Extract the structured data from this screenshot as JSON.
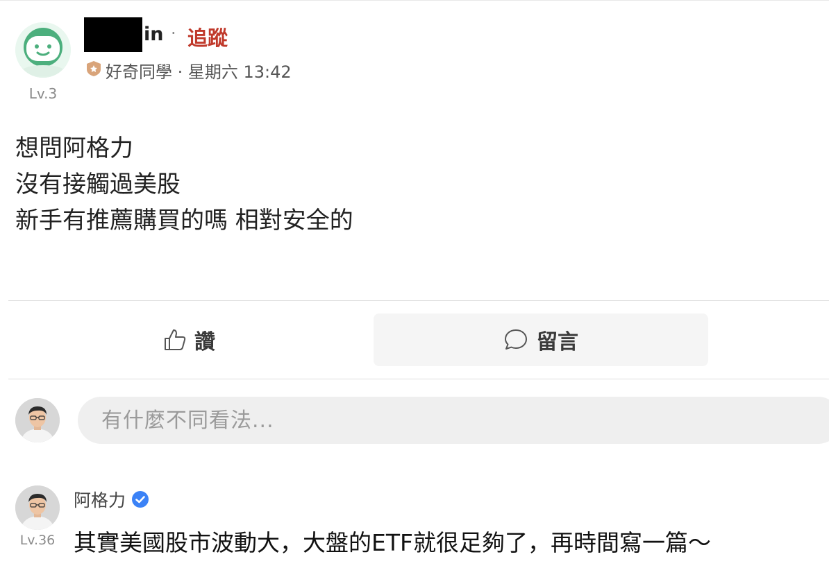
{
  "post": {
    "author_name_visible": "in",
    "follow_label": "追蹤",
    "separator": "·",
    "badge_icon": "shield-badge-icon",
    "meta_text": "好奇同學 · 星期六 13:42",
    "level": "Lv.3",
    "body_lines": [
      "想問阿格力",
      "沒有接觸過美股",
      "新手有推薦購買的嗎 相對安全的"
    ]
  },
  "actions": {
    "like_label": "讚",
    "like_icon": "thumbs-up-icon",
    "comment_label": "留言",
    "comment_icon": "speech-bubble-icon"
  },
  "comment_box": {
    "placeholder": "有什麼不同看法..."
  },
  "reply": {
    "name": "阿格力",
    "verified_icon": "verified-check-icon",
    "level": "Lv.36",
    "text": "其實美國股市波動大，大盤的ETF就很足夠了，再時間寫一篇～"
  },
  "colors": {
    "follow": "#c0392b",
    "verified": "#3b82f6",
    "avatar_green": "#4caf7d"
  }
}
